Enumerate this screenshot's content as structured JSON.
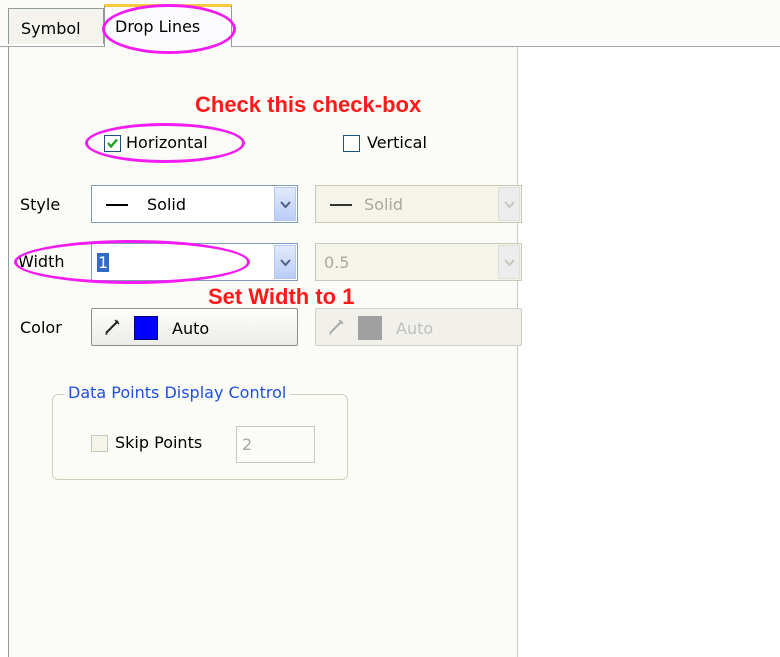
{
  "tabs": [
    {
      "label": "Symbol"
    },
    {
      "label": "Drop Lines"
    }
  ],
  "annotations": {
    "check_hint": "Check this check-box",
    "width_hint": "Set Width to 1"
  },
  "horizontal": {
    "label": "Horizontal",
    "checked": true
  },
  "vertical": {
    "label": "Vertical",
    "checked": false
  },
  "style": {
    "label": "Style",
    "horizontal_value": "Solid",
    "vertical_value": "Solid"
  },
  "width": {
    "label": "Width",
    "horizontal_value": "1",
    "vertical_value": "0.5"
  },
  "color": {
    "label": "Color",
    "horizontal_value": "Auto",
    "horizontal_swatch": "#0000ff",
    "vertical_value": "Auto",
    "vertical_swatch": "#a0a0a0"
  },
  "data_points": {
    "group_label": "Data Points Display Control",
    "skip_label": "Skip Points",
    "skip_checked": false,
    "skip_value": "2"
  },
  "colors": {
    "annotation_red": "#ff1a1a",
    "highlight_magenta": "#f21cf2",
    "group_title_blue": "#1e50dc",
    "tab_hot": "#ffc83c"
  }
}
